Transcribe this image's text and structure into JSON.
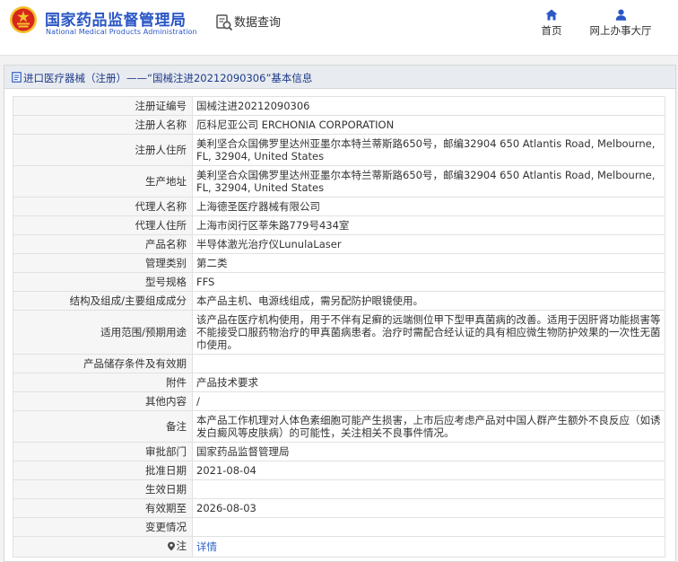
{
  "header": {
    "org_name": "国家药品监督管理局",
    "org_name_en": "National Medical Products Administration",
    "search_label": "数据查询",
    "nav": [
      {
        "label": "首页",
        "icon": "home-icon"
      },
      {
        "label": "网上办事大厅",
        "icon": "user-icon"
      }
    ]
  },
  "breadcrumb": {
    "text": "进口医疗器械（注册）——“国械注进20212090306”基本信息"
  },
  "details": [
    {
      "label": "注册证编号",
      "value": "国械注进20212090306"
    },
    {
      "label": "注册人名称",
      "value": "厄科尼亚公司 ERCHONIA CORPORATION"
    },
    {
      "label": "注册人住所",
      "value": "美利坚合众国佛罗里达州亚墨尔本特兰蒂斯路650号，邮编32904 650 Atlantis Road, Melbourne, FL, 32904, United States"
    },
    {
      "label": "生产地址",
      "value": "美利坚合众国佛罗里达州亚墨尔本特兰蒂斯路650号，邮编32904 650 Atlantis Road, Melbourne, FL, 32904, United States"
    },
    {
      "label": "代理人名称",
      "value": "上海德圣医疗器械有限公司"
    },
    {
      "label": "代理人住所",
      "value": "上海市闵行区莘朱路779号434室"
    },
    {
      "label": "产品名称",
      "value": "半导体激光治疗仪LunulaLaser"
    },
    {
      "label": "管理类别",
      "value": "第二类"
    },
    {
      "label": "型号规格",
      "value": "FFS"
    },
    {
      "label": "结构及组成/主要组成成分",
      "value": "本产品主机、电源线组成，需另配防护眼镜使用。"
    },
    {
      "label": "适用范围/预期用途",
      "value": "该产品在医疗机构使用，用于不伴有足癣的远端侧位甲下型甲真菌病的改善。适用于因肝肾功能损害等不能接受口服药物治疗的甲真菌病患者。治疗时需配合经认证的具有相应微生物防护效果的一次性无菌巾使用。"
    },
    {
      "label": "产品储存条件及有效期",
      "value": ""
    },
    {
      "label": "附件",
      "value": "产品技术要求"
    },
    {
      "label": "其他内容",
      "value": "/"
    },
    {
      "label": "备注",
      "value": "本产品工作机理对人体色素细胞可能产生损害，上市后应考虑产品对中国人群产生额外不良反应（如诱发白癜风等皮肤病）的可能性，关注相关不良事件情况。"
    },
    {
      "label": "审批部门",
      "value": "国家药品监督管理局"
    },
    {
      "label": "批准日期",
      "value": "2021-08-04"
    },
    {
      "label": "生效日期",
      "value": ""
    },
    {
      "label": "有效期至",
      "value": "2026-08-03"
    },
    {
      "label": "变更情况",
      "value": ""
    }
  ],
  "note_row": {
    "label": "注",
    "link": "详情"
  },
  "colors": {
    "brand_blue": "#2a56c6",
    "emblem_red": "#d8261c",
    "emblem_gold": "#f2c12e",
    "link": "#2a62c9"
  }
}
